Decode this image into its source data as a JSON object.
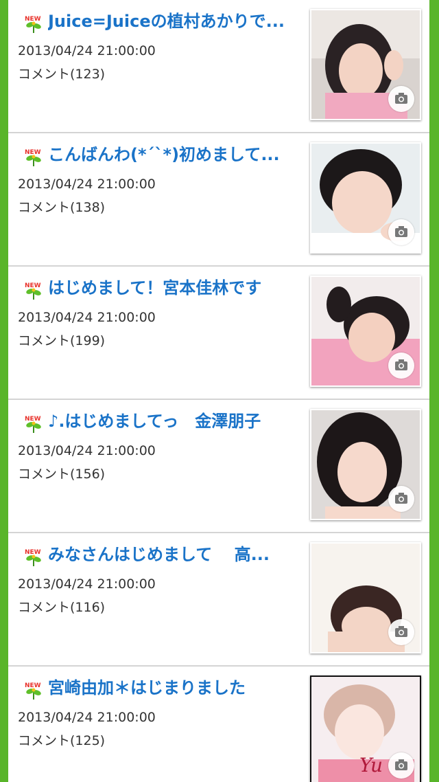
{
  "colors": {
    "background": "#59b52a",
    "title": "#1a73c8",
    "text": "#333333"
  },
  "badge_icon": "new-sprout-icon",
  "photo_icon": "camera-icon",
  "entries": [
    {
      "title": "Juice=Juiceの植村あかりで...",
      "date": "2013/04/24 21:00:00",
      "comment": "コメント(123)"
    },
    {
      "title": "こんばんわ(*´`*)初めまして...",
      "date": "2013/04/24 21:00:00",
      "comment": "コメント(138)"
    },
    {
      "title": "はじめまして！宮本佳林です",
      "date": "2013/04/24 21:00:00",
      "comment": "コメント(199)"
    },
    {
      "title": "♪.はじめましてっ　金澤朋子",
      "date": "2013/04/24 21:00:00",
      "comment": "コメント(156)"
    },
    {
      "title": "みなさんはじめまして　 高...",
      "date": "2013/04/24 21:00:00",
      "comment": "コメント(116)"
    },
    {
      "title": "宮崎由加＊はじまりました",
      "date": "2013/04/24 21:00:00",
      "comment": "コメント(125)"
    }
  ]
}
